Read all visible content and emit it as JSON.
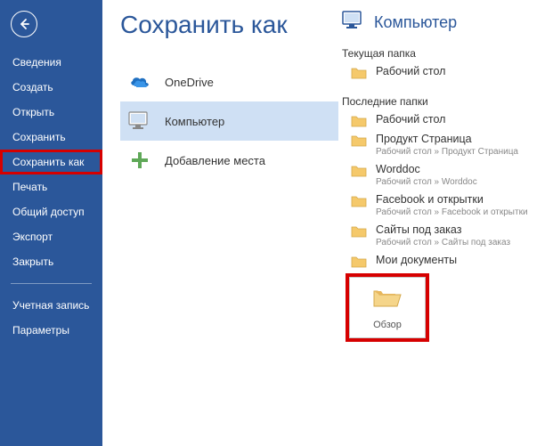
{
  "page_title": "Сохранить как",
  "sidebar": {
    "items": [
      {
        "label": "Сведения",
        "highlighted": false
      },
      {
        "label": "Создать",
        "highlighted": false
      },
      {
        "label": "Открыть",
        "highlighted": false
      },
      {
        "label": "Сохранить",
        "highlighted": false
      },
      {
        "label": "Сохранить как",
        "highlighted": true
      },
      {
        "label": "Печать",
        "highlighted": false
      },
      {
        "label": "Общий доступ",
        "highlighted": false
      },
      {
        "label": "Экспорт",
        "highlighted": false
      },
      {
        "label": "Закрыть",
        "highlighted": false
      }
    ],
    "footer_items": [
      {
        "label": "Учетная запись"
      },
      {
        "label": "Параметры"
      }
    ]
  },
  "locations": [
    {
      "label": "OneDrive",
      "icon": "onedrive",
      "selected": false
    },
    {
      "label": "Компьютер",
      "icon": "computer",
      "selected": true
    },
    {
      "label": "Добавление места",
      "icon": "add",
      "selected": false
    }
  ],
  "detail": {
    "header": "Компьютер",
    "current_section": "Текущая папка",
    "recent_section": "Последние папки",
    "current_folder": {
      "name": "Рабочий стол",
      "path": ""
    },
    "recent_folders": [
      {
        "name": "Рабочий стол",
        "path": ""
      },
      {
        "name": "Продукт Страница",
        "path": "Рабочий стол » Продукт Страница"
      },
      {
        "name": "Worddoc",
        "path": "Рабочий стол » Worddoc"
      },
      {
        "name": "Facebook и открытки",
        "path": "Рабочий стол » Facebook и открытки"
      },
      {
        "name": "Сайты под заказ",
        "path": "Рабочий стол » Сайты под заказ"
      },
      {
        "name": "Мои документы",
        "path": ""
      }
    ],
    "browse_label": "Обзор"
  },
  "colors": {
    "brand": "#2b579a",
    "highlight": "#d60000"
  }
}
